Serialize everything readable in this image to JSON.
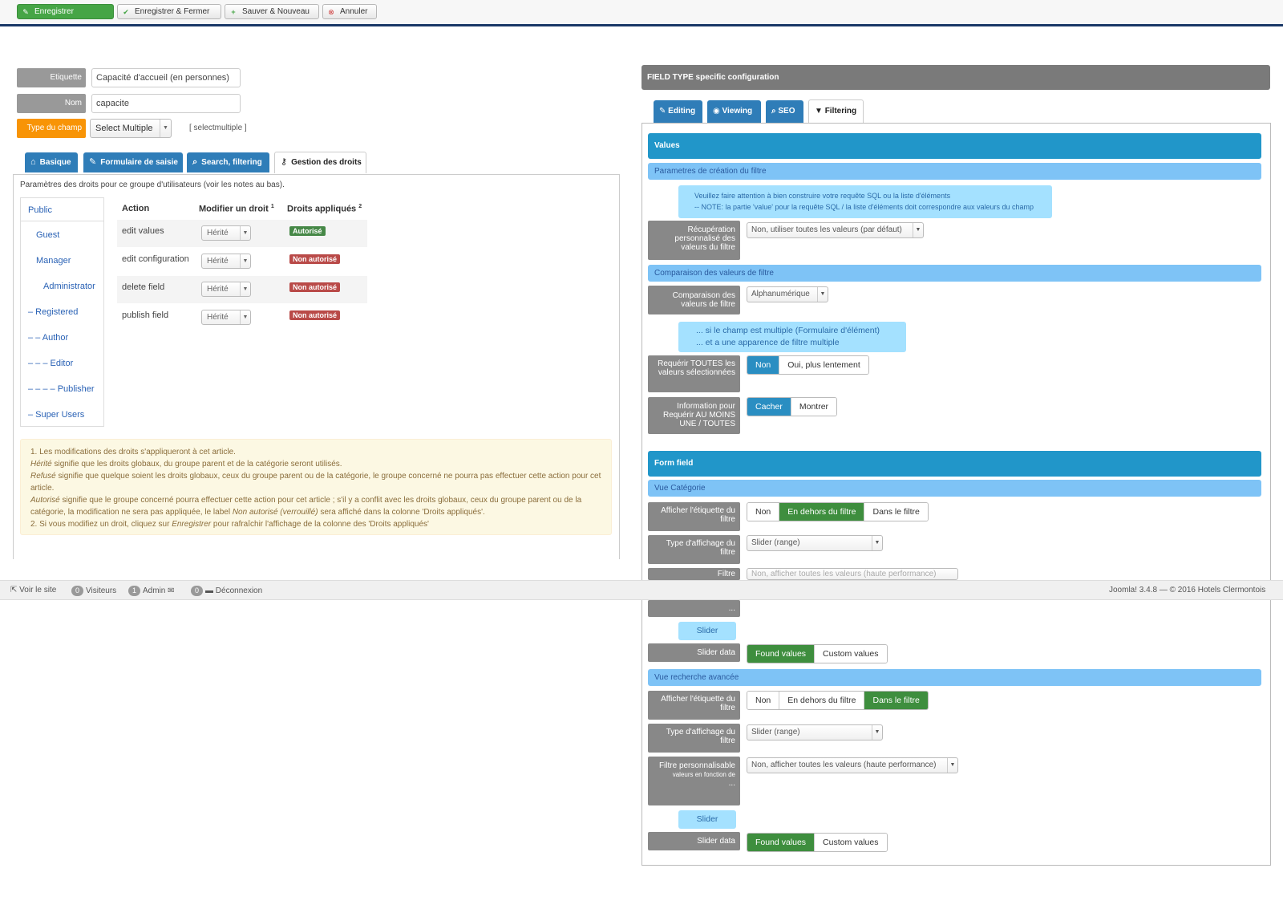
{
  "toolbar": {
    "save": "Enregistrer",
    "save_close": "Enregistrer & Fermer",
    "save_new": "Sauver & Nouveau",
    "cancel": "Annuler"
  },
  "form": {
    "label_etiquette": "Etiquette",
    "value_etiquette": "Capacité d'accueil (en personnes)",
    "label_nom": "Nom",
    "value_nom": "capacite",
    "label_type": "Type du champ",
    "value_type": "Select Multiple",
    "type_hint": "[ selectmultiple ]"
  },
  "left_tabs": [
    "Basique",
    "Formulaire de saisie",
    "Search, filtering",
    "Gestion des droits"
  ],
  "permissions": {
    "intro": "Paramètres des droits pour ce groupe d'utilisateurs (voir les notes au bas).",
    "groups": [
      "Public",
      "Guest",
      "Manager",
      "Administrator",
      "– Registered",
      "– – Author",
      "– – – Editor",
      "– – – – Publisher",
      "– Super Users"
    ],
    "headers": {
      "action": "Action",
      "modify": "Modifier un droit",
      "modify_sup": "1",
      "applied": "Droits appliqués",
      "applied_sup": "2"
    },
    "rows": [
      {
        "action": "edit values",
        "setting": "Hérité",
        "status": "Autorisé",
        "allowed": true
      },
      {
        "action": "edit configuration",
        "setting": "Hérité",
        "status": "Non autorisé",
        "allowed": false
      },
      {
        "action": "delete field",
        "setting": "Hérité",
        "status": "Non autorisé",
        "allowed": false
      },
      {
        "action": "publish field",
        "setting": "Hérité",
        "status": "Non autorisé",
        "allowed": false
      }
    ],
    "notes": {
      "n1": "1. Les modifications des droits s'appliqueront à cet article.",
      "n2a": "Hérité",
      "n2b": " signifie que les droits globaux, du groupe parent et de la catégorie seront utilisés.",
      "n3a": "Refusé",
      "n3b": " signifie que quelque soient les droits globaux, ceux du groupe parent ou de la catégorie, le groupe concerné ne pourra pas effectuer cette action pour cet article.",
      "n4a": "Autorisé",
      "n4b": " signifie que le groupe concerné pourra effectuer cette action pour cet article ; s'il y a conflit avec les droits globaux, ceux du groupe parent ou de la catégorie, la modification ne sera pas appliquée, le label ",
      "n4c": "Non autorisé (verrouillé)",
      "n4d": " sera affiché dans la colonne 'Droits appliqués'.",
      "n5a": "2. Si vous modifiez un droit, cliquez sur ",
      "n5b": "Enregistrer",
      "n5c": " pour rafraîchir l'affichage de la colonne des 'Droits appliqués'"
    }
  },
  "statusbar": {
    "view_site": "Voir le site",
    "visitors_count": "0",
    "visitors": "Visiteurs",
    "admin_count": "1",
    "admin": "Admin",
    "messages_count": "0",
    "logout": "Déconnexion",
    "footer": "Joomla! 3.4.8 — © 2016 Hotels Clermontois"
  },
  "right": {
    "title": "FIELD TYPE specific configuration",
    "tabs": [
      "Editing",
      "Viewing",
      "SEO",
      "Filtering"
    ],
    "values_section": "Values",
    "sub_filter_params": "Parametres de création du filtre",
    "info1_line1": "Veuillez faire attention à bien construire votre requête SQL ou la liste d'éléments",
    "info1_line2": "-- NOTE: la partie 'value' pour la requête SQL / la liste d'éléments doit correspondre aux valeurs du champ",
    "label_custom_fetch": "Récupération personnalisé des valeurs du filtre",
    "sel_custom_fetch": "Non, utiliser toutes les valeurs (par défaut)",
    "sub_compare": "Comparaison des valeurs de filtre",
    "label_compare": "Comparaison des valeurs de filtre",
    "sel_compare": "Alphanumérique",
    "info2_line1": "... si le champ est multiple (Formulaire d'élément)",
    "info2_line2": "... et a une apparence de filtre multiple",
    "label_require_all": "Requérir TOUTES les valeurs sélectionnées",
    "btn_non": "Non",
    "btn_oui_slow": "Oui, plus lentement",
    "label_info_at_least": "Information pour Requérir AU MOINS UNE / TOUTES",
    "btn_cacher": "Cacher",
    "btn_montrer": "Montrer",
    "form_field_section": "Form field",
    "sub_vue_categorie": "Vue Catégorie",
    "label_show_label": "Afficher l'étiquette du filtre",
    "btn_en_dehors": "En dehors du filtre",
    "btn_dans": "Dans le filtre",
    "label_display_type": "Type d'affichage du filtre",
    "sel_slider_range": "Slider (range)",
    "label_filter_custom_partial": "Filtre",
    "sel_custom_values": "Non, afficher toutes les valeurs (haute performance)",
    "ellipsis": "...",
    "slider": "Slider",
    "label_slider_data": "Slider data",
    "btn_found_values": "Found values",
    "btn_custom_values": "Custom values",
    "sub_vue_recherche": "Vue recherche avancée",
    "label_filter_custom": "Filtre personnalisable",
    "label_filter_custom_sub": "valeurs en fonction de",
    "label_filter_custom_more": "..."
  }
}
